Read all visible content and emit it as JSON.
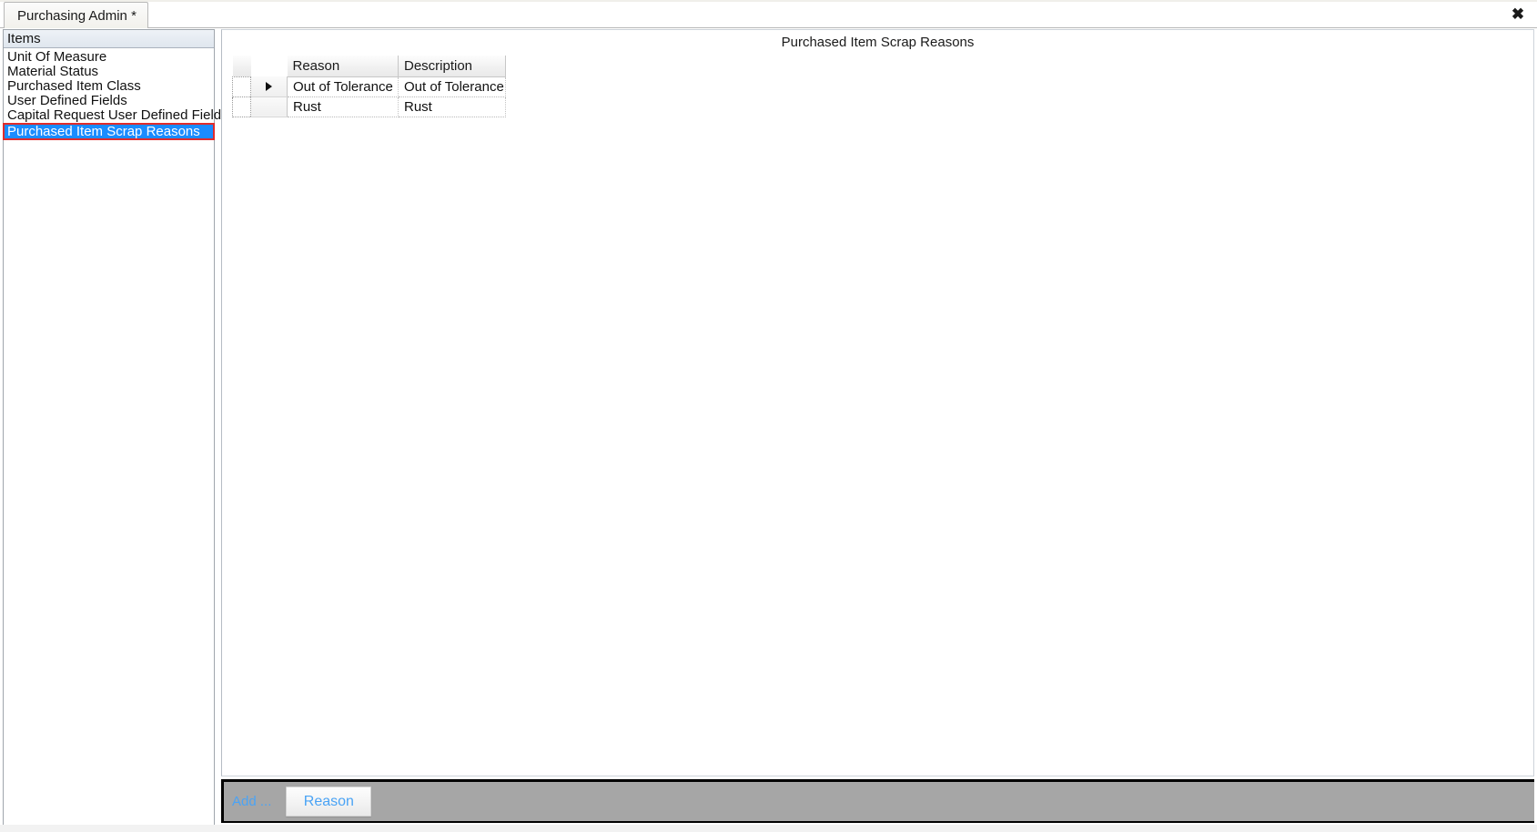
{
  "window": {
    "close_icon": "close-icon",
    "close_glyph": "✖"
  },
  "tabs": [
    {
      "label": "Purchasing Admin *",
      "active": true
    }
  ],
  "sidebar": {
    "header": "Items",
    "items": [
      {
        "label": "Unit Of Measure",
        "selected": false
      },
      {
        "label": "Material Status",
        "selected": false
      },
      {
        "label": "Purchased Item Class",
        "selected": false
      },
      {
        "label": "User Defined Fields",
        "selected": false
      },
      {
        "label": "Capital Request User Defined Fields",
        "selected": false
      },
      {
        "label": "Purchased Item Scrap Reasons",
        "selected": true
      }
    ]
  },
  "main": {
    "title": "Purchased Item Scrap Reasons",
    "grid": {
      "columns": [
        "Reason",
        "Description"
      ],
      "rows": [
        {
          "reason": "Out of Tolerance",
          "description": "Out of Tolerance",
          "selected": true,
          "marker": "▶"
        },
        {
          "reason": "Rust",
          "description": "Rust",
          "selected": false,
          "marker": ""
        }
      ]
    }
  },
  "bottom_bar": {
    "add_label": "Add ...",
    "reason_button": "Reason"
  },
  "colors": {
    "selection_blue": "#1a8cff",
    "highlight_red": "#e02c2c",
    "link_blue": "#4aa3f5",
    "bar_gray": "#a6a6a6"
  }
}
